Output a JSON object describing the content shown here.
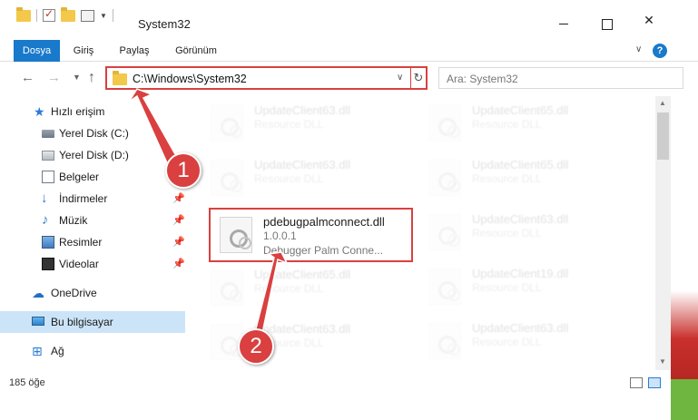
{
  "window": {
    "title": "System32"
  },
  "ribbon": {
    "tabs": [
      "Dosya",
      "Giriş",
      "Paylaş",
      "Görünüm"
    ],
    "help": "?"
  },
  "nav": {
    "address": "C:\\Windows\\System32",
    "search_placeholder": "Ara: System32"
  },
  "sidebar": {
    "items": [
      {
        "label": "Hızlı erişim",
        "icon": "star-icon"
      },
      {
        "label": "Yerel Disk (C:)",
        "icon": "drive-icon"
      },
      {
        "label": "Yerel Disk (D:)",
        "icon": "drive-icon"
      },
      {
        "label": "Belgeler",
        "icon": "document-icon"
      },
      {
        "label": "İndirmeler",
        "icon": "download-icon"
      },
      {
        "label": "Müzik",
        "icon": "music-icon"
      },
      {
        "label": "Resimler",
        "icon": "pictures-icon"
      },
      {
        "label": "Videolar",
        "icon": "video-icon"
      },
      {
        "label": "OneDrive",
        "icon": "cloud-icon"
      },
      {
        "label": "Bu bilgisayar",
        "icon": "computer-icon"
      },
      {
        "label": "Ağ",
        "icon": "network-icon"
      }
    ]
  },
  "files": {
    "left": [
      {
        "name": "UpdateClient63.dll",
        "desc": "Resource DLL"
      },
      {
        "name": "UpdateClient63.dll",
        "desc": "Resource DLL"
      },
      {
        "name": "pdebugpalmconnect.dll",
        "version": "1.0.0.1",
        "desc": "Debugger Palm Conne..."
      },
      {
        "name": "UpdateClient65.dll",
        "desc": "Resource DLL"
      },
      {
        "name": "UpdateClient63.dll",
        "desc": "Resource DLL"
      }
    ],
    "right": [
      {
        "name": "UpdateClient65.dll",
        "desc": "Resource DLL"
      },
      {
        "name": "UpdateClient65.dll",
        "desc": "Resource DLL"
      },
      {
        "name": "UpdateClient63.dll",
        "desc": "Resource DLL"
      },
      {
        "name": "UpdateClient19.dll",
        "desc": "Resource DLL"
      },
      {
        "name": "UpdateClient63.dll",
        "desc": "Resource DLL"
      }
    ]
  },
  "status": {
    "count": "185 öğe"
  },
  "annotations": {
    "step1": "1",
    "step2": "2",
    "color": "#d9403f"
  }
}
